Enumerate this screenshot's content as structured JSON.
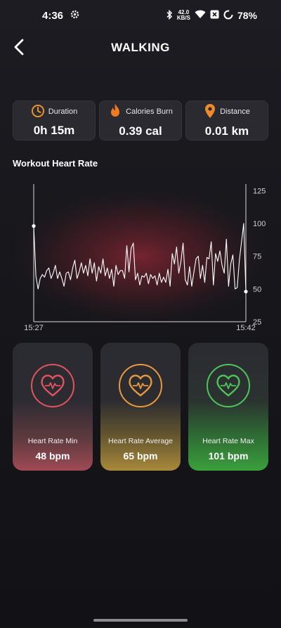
{
  "status_bar": {
    "time": "4:36",
    "net_speed_value": "42.0",
    "net_speed_unit": "KB/S",
    "battery_percent": "78%"
  },
  "header": {
    "title": "WALKING"
  },
  "stats": [
    {
      "icon": "clock-icon",
      "label": "Duration",
      "value": "0h 15m",
      "color": "#e9922e"
    },
    {
      "icon": "flame-icon",
      "label": "Calories Burn",
      "value": "0.39 cal",
      "color": "#f07a1e"
    },
    {
      "icon": "location-pin-icon",
      "label": "Distance",
      "value": "0.01 km",
      "color": "#ef8a2a"
    }
  ],
  "chart_title": "Workout Heart Rate",
  "chart_data": {
    "type": "line",
    "title": "Workout Heart Rate",
    "xlabel": "",
    "ylabel": "",
    "x_tick_labels": [
      "15:27",
      "15:42"
    ],
    "y_ticks": [
      125,
      100,
      75,
      50,
      25
    ],
    "ylim": [
      25,
      130
    ],
    "grid": false,
    "line_color": "#ffffff",
    "series": [
      {
        "values": [
          98,
          60,
          50,
          58,
          61,
          59,
          64,
          66,
          58,
          62,
          68,
          58,
          63,
          58,
          52,
          62,
          63,
          57,
          66,
          72,
          58,
          63,
          70,
          62,
          68,
          60,
          73,
          62,
          70,
          56,
          67,
          62,
          73,
          60,
          66,
          58,
          65,
          52,
          68,
          61,
          64,
          64,
          58,
          83,
          63,
          81,
          85,
          57,
          62,
          53,
          60,
          59,
          62,
          54,
          61,
          58,
          60,
          53,
          62,
          55,
          59,
          55,
          65,
          52,
          77,
          69,
          82,
          62,
          71,
          85,
          57,
          53,
          67,
          52,
          63,
          73,
          75,
          58,
          68,
          55,
          74,
          73,
          86,
          53,
          77,
          71,
          79,
          68,
          62,
          88,
          52,
          69,
          76,
          50,
          51,
          72,
          86,
          100,
          48
        ]
      }
    ]
  },
  "heart_rate_cards": [
    {
      "id": "min",
      "label": "Heart Rate Min",
      "value": "48 bpm",
      "color": "#e0545e"
    },
    {
      "id": "avg",
      "label": "Heart Rate Average",
      "value": "65 bpm",
      "color": "#e69a3e"
    },
    {
      "id": "max",
      "label": "Heart Rate Max",
      "value": "101 bpm",
      "color": "#4fc45a"
    }
  ]
}
